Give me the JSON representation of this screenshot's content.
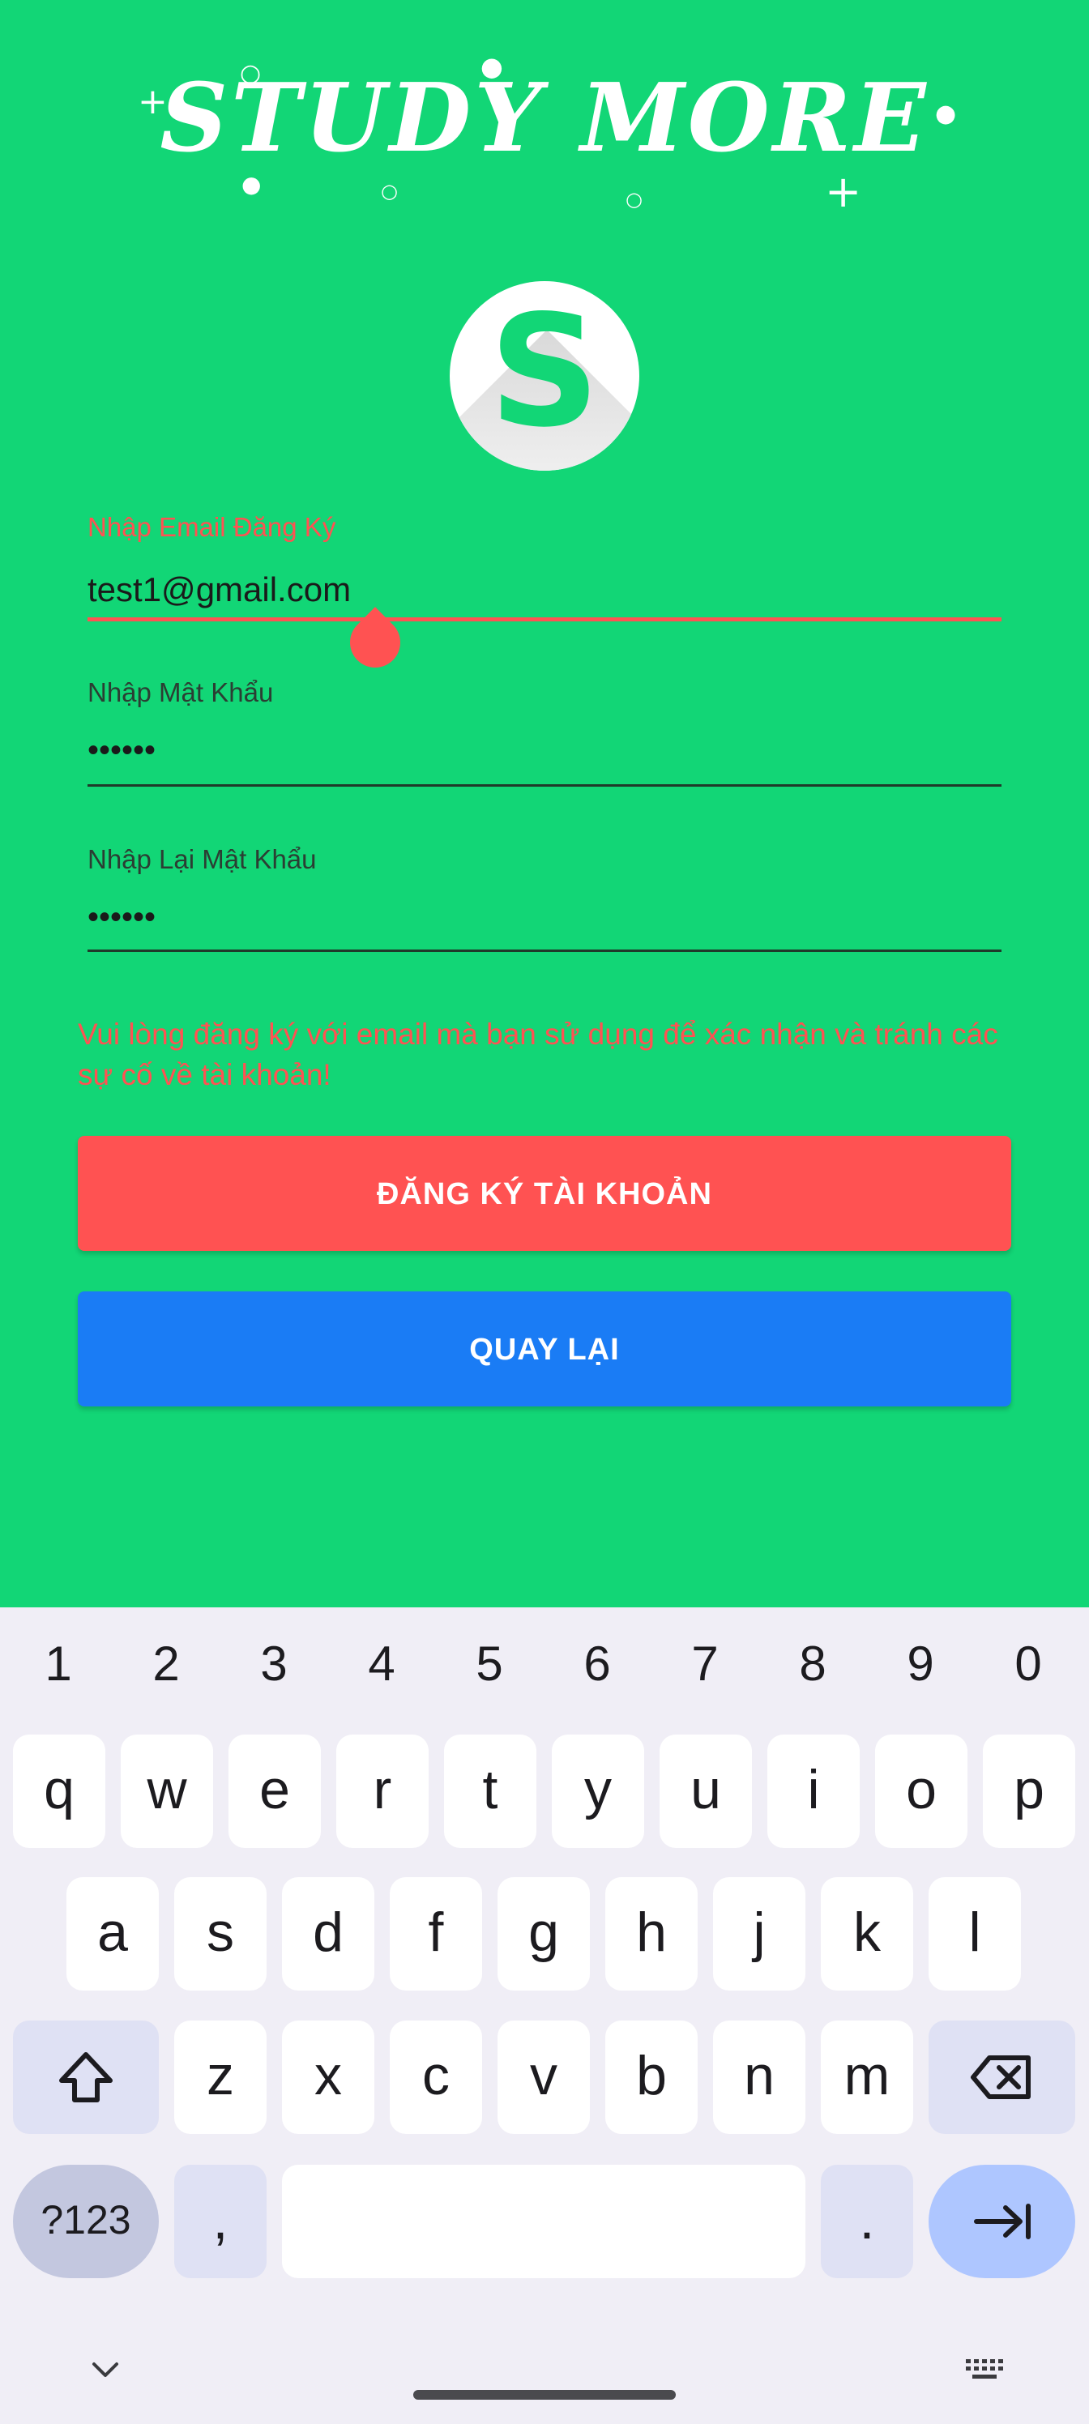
{
  "app": {
    "title": "STUDY MORE",
    "logo_letter": "S",
    "email_field": {
      "label": "Nhập Email Đăng Ký",
      "value": "test1@gmail.com"
    },
    "password_field": {
      "label": "Nhập Mật Khẩu",
      "value": "••••••"
    },
    "confirm_password_field": {
      "label": "Nhập Lại Mật Khẩu",
      "value": "••••••"
    },
    "warning": "Vui lòng đăng ký với email mà bạn sử dụng để xác nhận và tránh các sự cố về tài khoản!",
    "register_button": "ĐĂNG KÝ TÀI KHOẢN",
    "back_button": "QUAY LẠI",
    "colors": {
      "background": "#12d676",
      "error": "#ff5252",
      "back_button": "#1a7cf5"
    }
  },
  "keyboard": {
    "numbers": [
      "1",
      "2",
      "3",
      "4",
      "5",
      "6",
      "7",
      "8",
      "9",
      "0"
    ],
    "row1": [
      "q",
      "w",
      "e",
      "r",
      "t",
      "y",
      "u",
      "i",
      "o",
      "p"
    ],
    "row2": [
      "a",
      "s",
      "d",
      "f",
      "g",
      "h",
      "j",
      "k",
      "l"
    ],
    "row3": [
      "z",
      "x",
      "c",
      "v",
      "b",
      "n",
      "m"
    ],
    "symbols_key": "?123",
    "comma_key": ",",
    "period_key": ".",
    "shift_icon": "shift-icon",
    "backspace_icon": "backspace-icon",
    "enter_icon": "tab-arrow-icon",
    "hide_icon": "chevron-down-icon",
    "switch_icon": "keyboard-icon"
  }
}
